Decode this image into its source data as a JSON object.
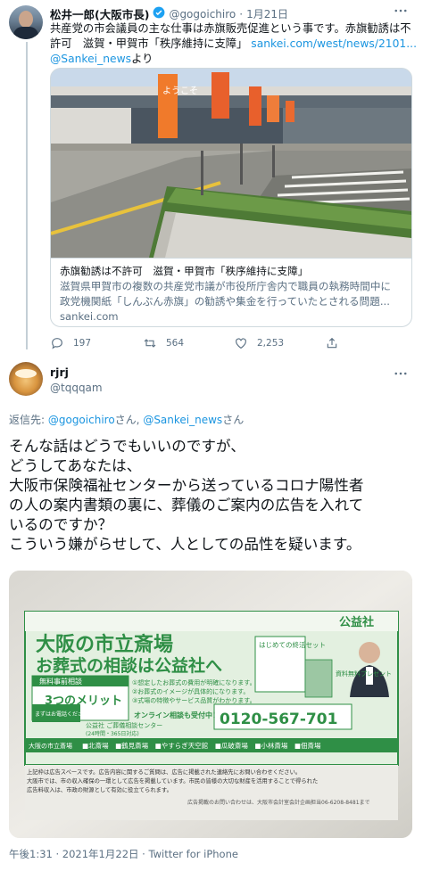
{
  "tweet1": {
    "author_name": "松井一郎(大阪市長)",
    "handle": "@gogoichiro",
    "date": "1月21日",
    "text_line1": "共産党の市会議員の主な仕事は赤旗販売促進という事です。赤旗勧誘は不",
    "text_line2_a": "許可　滋賀・甲賀市「秩序維持に支障」",
    "text_line2_link": "sankei.com/west/news/2101...",
    "via_handle": "@Sankei_news",
    "via_suffix": "より",
    "card": {
      "title": "赤旗勧誘は不許可　滋賀・甲賀市「秩序維持に支障」",
      "desc_line1": "滋賀県甲賀市の複数の共産党市議が市役所庁舎内で職員の執務時間中に",
      "desc_line2": "政党機関紙「しんぶん赤旗」の勧誘や集金を行っていたとされる問題...",
      "domain": "sankei.com",
      "image_banner_text": "ようこそ"
    },
    "actions": {
      "replies": "197",
      "retweets": "564",
      "likes": "2,253"
    }
  },
  "tweet2": {
    "author_name": "rjrj",
    "handle": "@tqqqam",
    "reply_prefix": "返信先: ",
    "reply_to1": "@gogoichiro",
    "reply_mid": "さん, ",
    "reply_to2": "@Sankei_news",
    "reply_suffix": "さん",
    "lines": [
      "そんな話はどうでもいいのですが、",
      "どうしてあなたは、",
      "大阪市保険福祉センターから送っているコロナ陽性者",
      "の人の案内書類の裏に、葬儀のご案内の広告を入れて",
      "いるのですか？",
      "こういう嫌がらせして、人としての品性を疑います。"
    ],
    "photo": {
      "logo": "公益社",
      "headline1": "大阪の市立斎場",
      "headline2": "お葬式の相談は公益社へ",
      "side_box": "はじめての終活セット",
      "consult_label": "無料事前相談",
      "merits": "3つのメリット",
      "merit1": "①想定したお葬式の費用が明確になります。",
      "merit2": "②お葬式のイメージが具体的になります。",
      "merit3": "③式場の特徴やサービス品質がわかります。",
      "online": "オンライン相談も受付中！",
      "phone_label": "まずはお電話ください",
      "phone_center": "公益社 ご葬儀相談センター",
      "phone_hours": "(24時間・365日対応)",
      "phone": "0120-567-701",
      "gift_label": "資料無料プレゼント",
      "halls_label": "大阪の市立斎場",
      "halls": "■北斎場　■鶴見斎場　■やすらぎ天空館　■瓜破斎場　■小林斎場　■佃斎場",
      "fine1": "上記枠は広告スペースです。広告内容に関するご質問は、広告に掲載された連絡先にお問い合わせください。",
      "fine2": "大阪市では、市の収入確保の一環として広告を掲載しています。市民の皆様の大切な財産を活用することで得られた",
      "fine3": "広告料収入は、市政の財源として有効に役立てられます。",
      "fine4": "広告掲載のお問い合わせは、大阪市会計室会計企画担当06-6208-8481まで"
    },
    "footer": "午後1:31 · 2021年1月22日 · Twitter for iPhone"
  },
  "colors": {
    "link": "#1b95e0",
    "muted": "#5b7083",
    "ad_green": "#2f8f46"
  }
}
